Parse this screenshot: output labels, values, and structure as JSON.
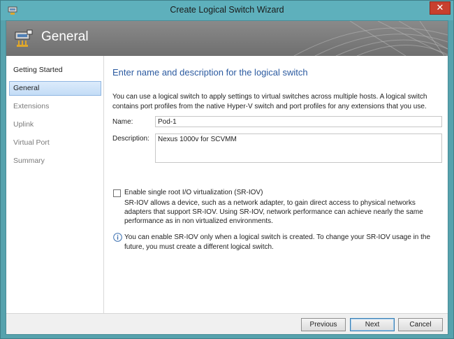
{
  "window": {
    "title": "Create Logical Switch Wizard",
    "close_glyph": "✕"
  },
  "banner": {
    "title": "General"
  },
  "sidebar": {
    "items": [
      {
        "label": "Getting Started",
        "state": "done"
      },
      {
        "label": "General",
        "state": "active"
      },
      {
        "label": "Extensions",
        "state": "pending"
      },
      {
        "label": "Uplink",
        "state": "pending"
      },
      {
        "label": "Virtual Port",
        "state": "pending"
      },
      {
        "label": "Summary",
        "state": "pending"
      }
    ]
  },
  "main": {
    "heading": "Enter name and description for the logical switch",
    "intro": "You can use a logical switch to apply settings to virtual switches across multiple hosts. A logical switch contains port profiles from the native Hyper-V switch and port profiles for any extensions that you use.",
    "name_label": "Name:",
    "name_value": "Pod-1",
    "description_label": "Description:",
    "description_value": "Nexus 1000v for SCVMM",
    "sriov_checkbox_label": "Enable single root I/O virtualization (SR-IOV)",
    "sriov_checked": false,
    "sriov_text": "SR-IOV allows a device, such as a network adapter, to gain direct access to physical networks adapters that support SR-IOV. Using SR-IOV, network performance can achieve nearly the same performance as in non virtualized environments.",
    "info_text": "You can enable SR-IOV only when a logical switch is created. To change your SR-IOV usage in the future, you must create a different logical switch."
  },
  "footer": {
    "previous_label": "Previous",
    "next_label": "Next",
    "cancel_label": "Cancel"
  },
  "colors": {
    "accent": "#2b5aa0",
    "selection": "#c3dcf6",
    "window_frame": "#56a2ad",
    "close": "#c8402f"
  }
}
